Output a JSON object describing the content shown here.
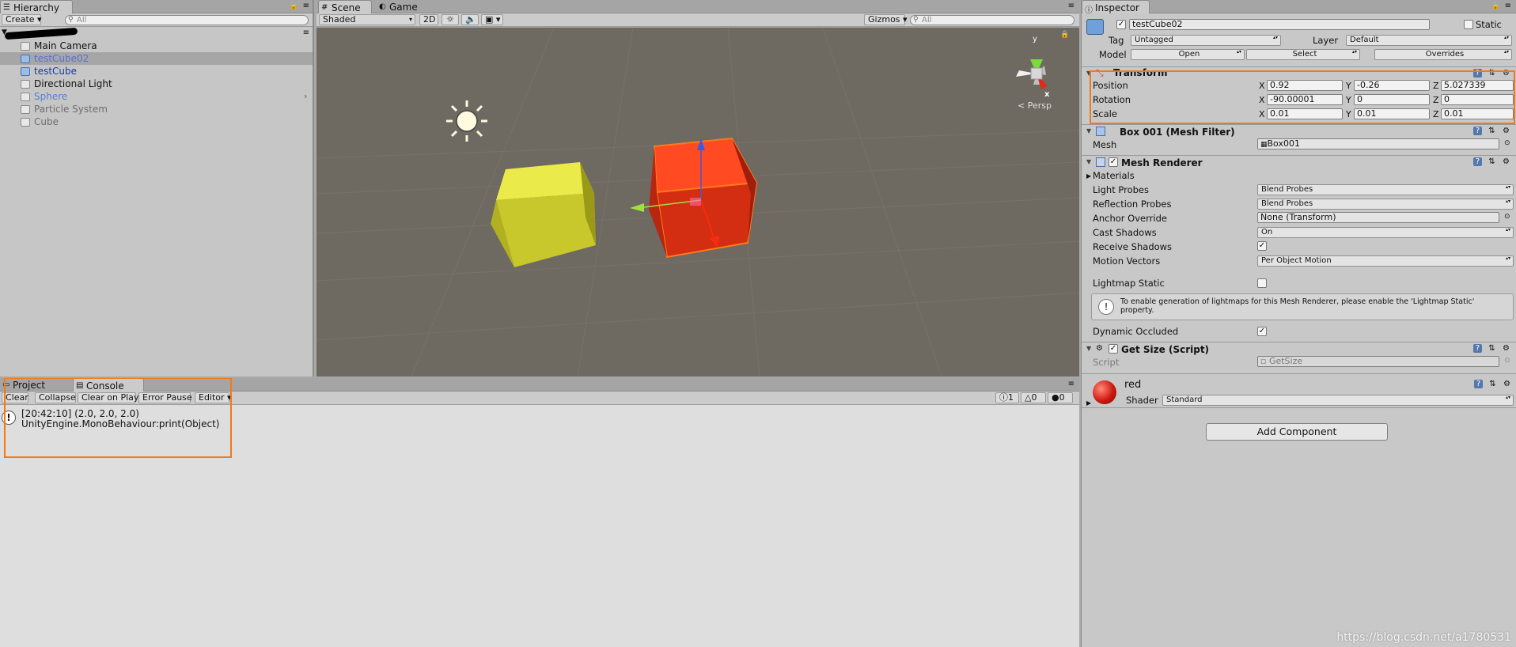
{
  "hierarchy": {
    "tab_label": "Hierarchy",
    "create_label": "Create",
    "search_placeholder": "All",
    "scene_name": "",
    "items": [
      {
        "label": "Main Camera",
        "color": "#111111"
      },
      {
        "label": "testCube02",
        "color": "#5b6fd8"
      },
      {
        "label": "testCube",
        "color": "#1a3aa8"
      },
      {
        "label": "Directional Light",
        "color": "#111111"
      },
      {
        "label": "Sphere",
        "color": "#5a7fd0"
      },
      {
        "label": "Particle System",
        "color": "#6e6e6e"
      },
      {
        "label": "Cube",
        "color": "#6e6e6e"
      }
    ]
  },
  "scene": {
    "tabs": [
      {
        "label": "Scene"
      },
      {
        "label": "Game"
      }
    ],
    "shading_mode": "Shaded",
    "mode_2d": "2D",
    "gizmos_label": "Gizmos",
    "search_placeholder": "All",
    "projection": "Persp",
    "gizmo_axes": {
      "x": "x",
      "y": "y"
    }
  },
  "console": {
    "tabs": [
      {
        "label": "Project"
      },
      {
        "label": "Console"
      }
    ],
    "buttons": [
      "Clear",
      "Collapse",
      "Clear on Play",
      "Error Pause",
      "Editor"
    ],
    "counts": {
      "info": "1",
      "warn": "0",
      "error": "0"
    },
    "log": {
      "line1": "[20:42:10] (2.0, 2.0, 2.0)",
      "line2": "UnityEngine.MonoBehaviour:print(Object)"
    }
  },
  "inspector": {
    "tab_label": "Inspector",
    "object_name": "testCube02",
    "static_label": "Static",
    "tag_label": "Tag",
    "tag_value": "Untagged",
    "layer_label": "Layer",
    "layer_value": "Default",
    "model_label": "Model",
    "model_open": "Open",
    "model_select": "Select",
    "model_overrides": "Overrides",
    "transform": {
      "title": "Transform",
      "rows": [
        {
          "label": "Position",
          "x": "0.92",
          "y": "-0.26",
          "z": "5.027339"
        },
        {
          "label": "Rotation",
          "x": "-90.00001",
          "y": "0",
          "z": "0"
        },
        {
          "label": "Scale",
          "x": "0.01",
          "y": "0.01",
          "z": "0.01"
        }
      ],
      "axis_x": "X",
      "axis_y": "Y",
      "axis_z": "Z"
    },
    "mesh_filter": {
      "title": "Box 001 (Mesh Filter)",
      "mesh_label": "Mesh",
      "mesh_value": "Box001"
    },
    "mesh_renderer": {
      "title": "Mesh Renderer",
      "materials_label": "Materials",
      "light_probes_label": "Light Probes",
      "light_probes_value": "Blend Probes",
      "reflection_probes_label": "Reflection Probes",
      "reflection_probes_value": "Blend Probes",
      "anchor_label": "Anchor Override",
      "anchor_value": "None (Transform)",
      "cast_label": "Cast Shadows",
      "cast_value": "On",
      "receive_label": "Receive Shadows",
      "motion_label": "Motion Vectors",
      "motion_value": "Per Object Motion",
      "lightmap_label": "Lightmap Static",
      "info_text": "To enable generation of lightmaps for this Mesh Renderer, please enable the 'Lightmap Static' property.",
      "dynamic_label": "Dynamic Occluded"
    },
    "script_comp": {
      "title": "Get Size (Script)",
      "script_label": "Script",
      "script_value": "GetSize"
    },
    "material": {
      "name": "red",
      "shader_label": "Shader",
      "shader_value": "Standard"
    },
    "add_component_label": "Add Component"
  },
  "watermark": "https://blog.csdn.net/a1780531",
  "colors": {
    "highlight": "#f07a1a",
    "scene_bg": "#6e6961",
    "red_cube": "#e23a17",
    "yellow_cube": "#e2e23a"
  }
}
